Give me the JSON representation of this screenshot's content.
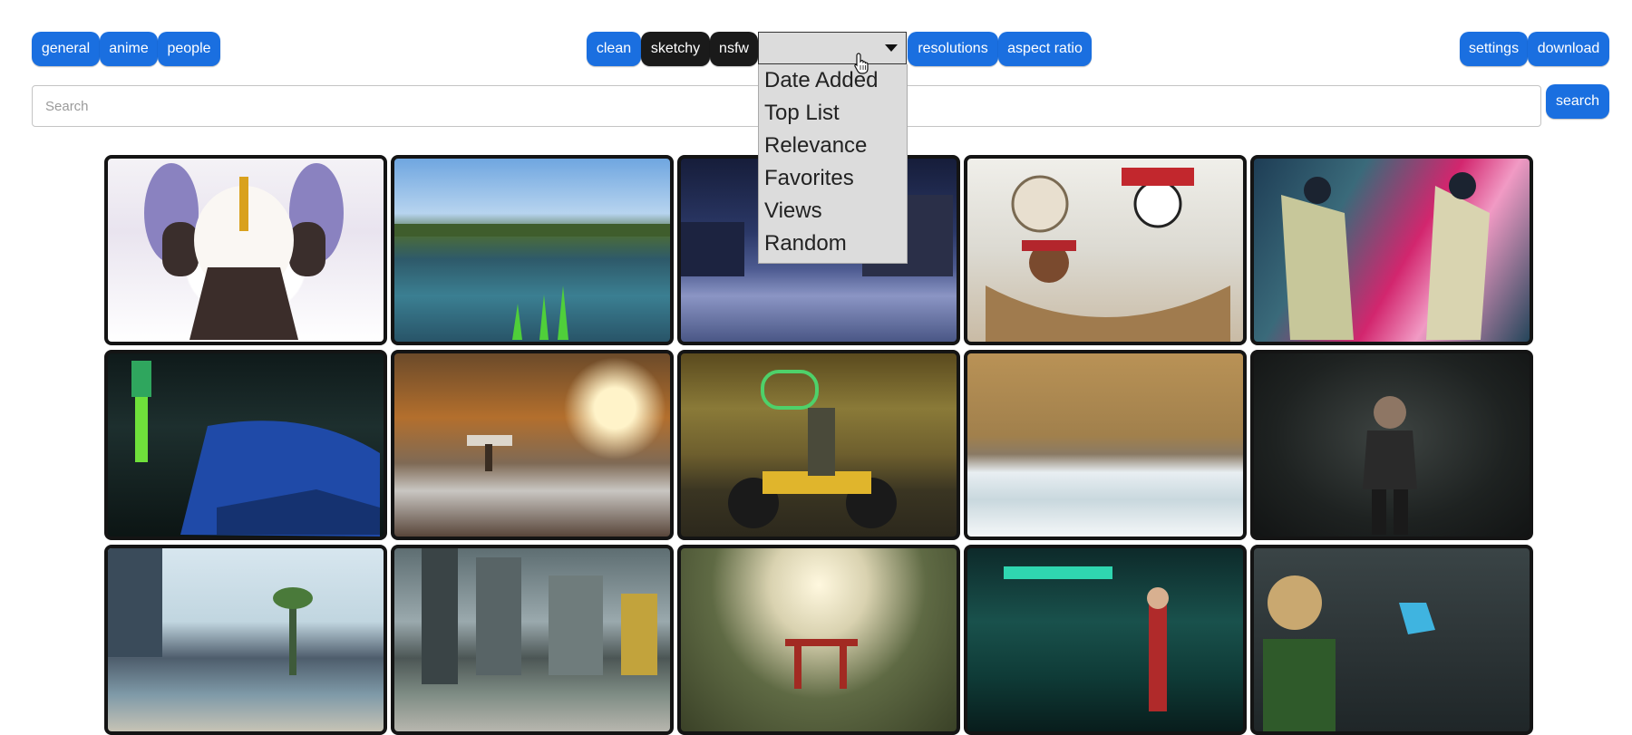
{
  "toolbar": {
    "categories": [
      "general",
      "anime",
      "people"
    ],
    "purity": [
      "clean",
      "sketchy",
      "nsfw"
    ],
    "filters": [
      "resolutions",
      "aspect ratio"
    ],
    "settings_label": "settings",
    "download_label": "download"
  },
  "sort": {
    "selected": "",
    "options": [
      "Date Added",
      "Top List",
      "Relevance",
      "Favorites",
      "Views",
      "Random"
    ]
  },
  "search": {
    "placeholder": "Search",
    "button_label": "search"
  },
  "colors": {
    "accent": "#1a6fe0",
    "active_toggle": "#1a1a1a",
    "dropdown_bg": "#dcdcdc"
  },
  "wallpapers": [
    {
      "subject": "anime maid character"
    },
    {
      "subject": "voxel lake landscape"
    },
    {
      "subject": "snowy night street"
    },
    {
      "subject": "pirate ship cartoon"
    },
    {
      "subject": "colorful abstract anime art"
    },
    {
      "subject": "neon figure and blue sports car"
    },
    {
      "subject": "autumn forest sunlight"
    },
    {
      "subject": "motorcycle rider at shop front"
    },
    {
      "subject": "aerial beach waves"
    },
    {
      "subject": "woman in dark room"
    },
    {
      "subject": "futuristic city plaza"
    },
    {
      "subject": "city with smoke and buildings"
    },
    {
      "subject": "torii gate garden"
    },
    {
      "subject": "neon green bar interior"
    },
    {
      "subject": "character facing cyber wall"
    }
  ]
}
